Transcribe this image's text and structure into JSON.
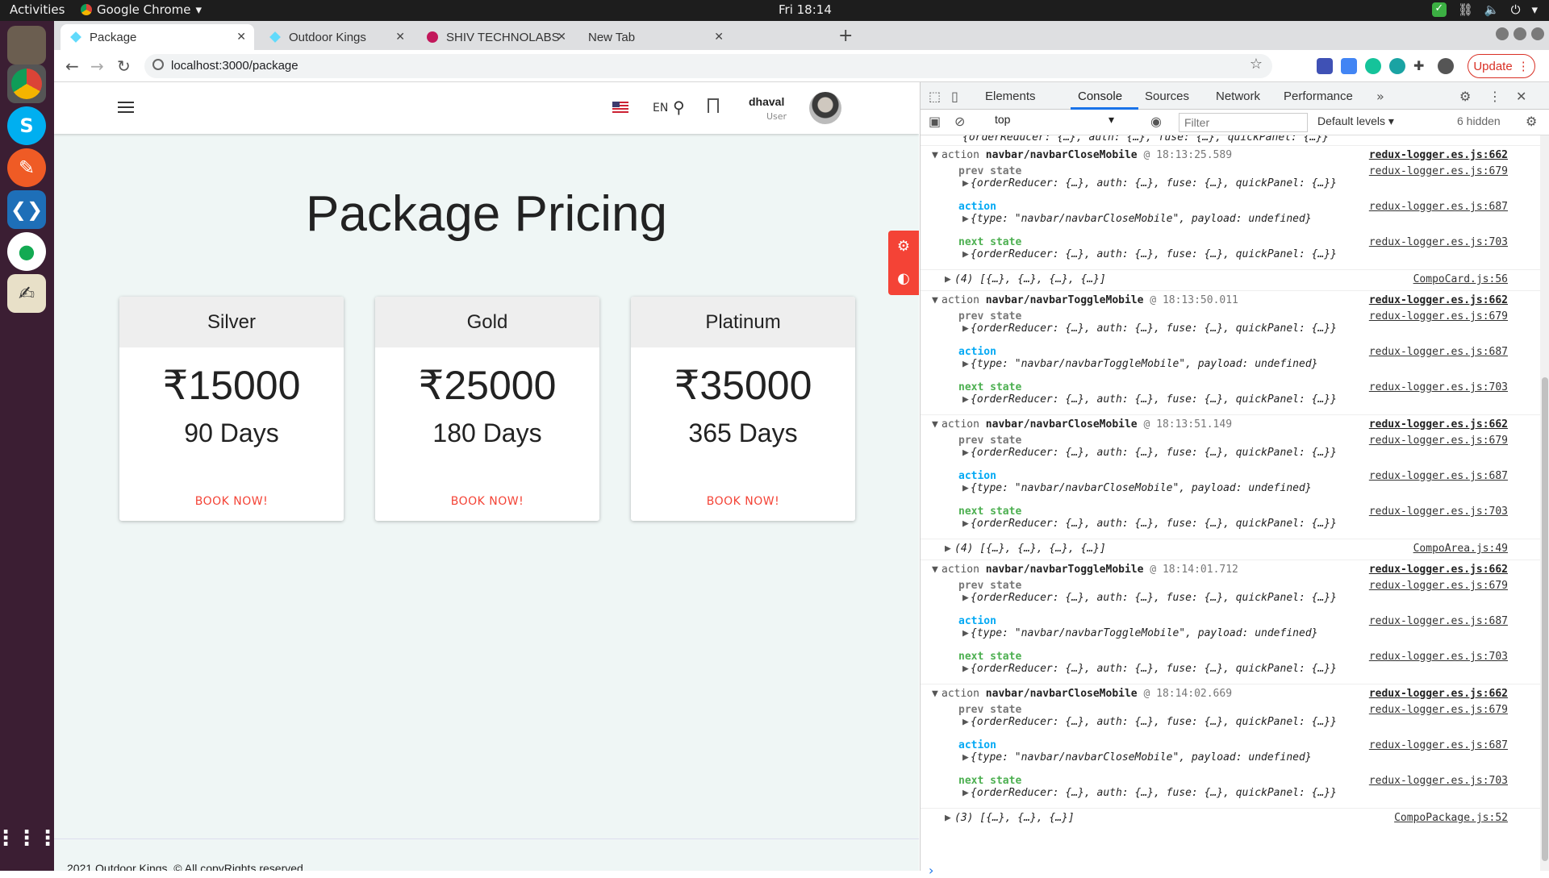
{
  "os": {
    "activities": "Activities",
    "app_name": "Google Chrome",
    "clock": "Fri 18:14"
  },
  "tabs": [
    {
      "label": "Package"
    },
    {
      "label": "Outdoor Kings"
    },
    {
      "label": "SHIV TECHNOLABS"
    },
    {
      "label": "New Tab"
    }
  ],
  "address": {
    "url": "localhost:3000/package"
  },
  "update_label": "Update",
  "page": {
    "lang": "EN",
    "user_name": "dhaval",
    "user_role": "User",
    "title": "Package Pricing",
    "packages": [
      {
        "name": "Silver",
        "price": "₹15000",
        "days": "90 Days",
        "cta": "BOOK NOW!"
      },
      {
        "name": "Gold",
        "price": "₹25000",
        "days": "180 Days",
        "cta": "BOOK NOW!"
      },
      {
        "name": "Platinum",
        "price": "₹35000",
        "days": "365 Days",
        "cta": "BOOK NOW!"
      }
    ],
    "footer": "2021 Outdoor Kings. © All copyRights reserved"
  },
  "devtools": {
    "tabs": [
      "Elements",
      "Console",
      "Sources",
      "Network",
      "Performance"
    ],
    "active_tab": "Console",
    "context": "top",
    "filter_placeholder": "Filter",
    "levels": "Default levels",
    "hidden": "6 hidden",
    "state_obj": "{orderReducer: {…}, auth: {…}, fuse: {…}, quickPanel: {…}}",
    "entries": [
      {
        "kind": "group",
        "action": "navbar/navbarCloseMobile",
        "time": "@ 18:13:25.589",
        "src_head": "redux-logger.es.js:662",
        "src_prev": "redux-logger.es.js:679",
        "src_action": "redux-logger.es.js:687",
        "src_next": "redux-logger.es.js:703",
        "payload": "{type: \"navbar/navbarCloseMobile\", payload: undefined}"
      },
      {
        "kind": "array",
        "text": "(4) [{…}, {…}, {…}, {…}]",
        "src": "CompoCard.js:56"
      },
      {
        "kind": "group",
        "action": "navbar/navbarToggleMobile",
        "time": "@ 18:13:50.011",
        "src_head": "redux-logger.es.js:662",
        "src_prev": "redux-logger.es.js:679",
        "src_action": "redux-logger.es.js:687",
        "src_next": "redux-logger.es.js:703",
        "payload": "{type: \"navbar/navbarToggleMobile\", payload: undefined}"
      },
      {
        "kind": "group",
        "action": "navbar/navbarCloseMobile",
        "time": "@ 18:13:51.149",
        "src_head": "redux-logger.es.js:662",
        "src_prev": "redux-logger.es.js:679",
        "src_action": "redux-logger.es.js:687",
        "src_next": "redux-logger.es.js:703",
        "payload": "{type: \"navbar/navbarCloseMobile\", payload: undefined}"
      },
      {
        "kind": "array",
        "text": "(4) [{…}, {…}, {…}, {…}]",
        "src": "CompoArea.js:49"
      },
      {
        "kind": "group",
        "action": "navbar/navbarToggleMobile",
        "time": "@ 18:14:01.712",
        "src_head": "redux-logger.es.js:662",
        "src_prev": "redux-logger.es.js:679",
        "src_action": "redux-logger.es.js:687",
        "src_next": "redux-logger.es.js:703",
        "payload": "{type: \"navbar/navbarToggleMobile\", payload: undefined}"
      },
      {
        "kind": "group",
        "action": "navbar/navbarCloseMobile",
        "time": "@ 18:14:02.669",
        "src_head": "redux-logger.es.js:662",
        "src_prev": "redux-logger.es.js:679",
        "src_action": "redux-logger.es.js:687",
        "src_next": "redux-logger.es.js:703",
        "payload": "{type: \"navbar/navbarCloseMobile\", payload: undefined}"
      },
      {
        "kind": "array",
        "text": "(3) [{…}, {…}, {…}]",
        "src": "CompoPackage.js:52"
      }
    ],
    "labels": {
      "prev": "prev state",
      "action": "action",
      "next": "next state",
      "head": "action"
    }
  }
}
